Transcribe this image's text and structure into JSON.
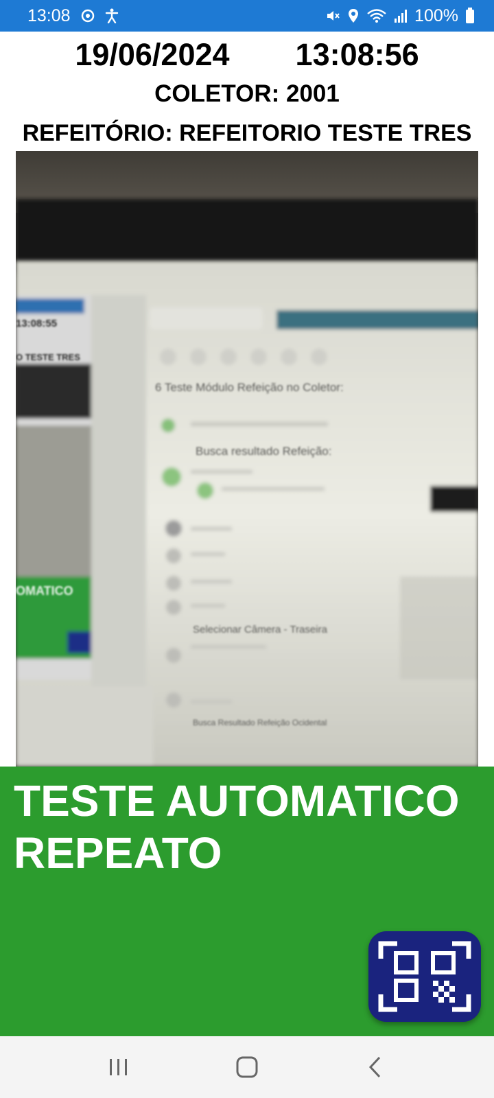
{
  "status_bar": {
    "time": "13:08",
    "battery": "100%",
    "icons_left": [
      "sync-icon",
      "accessibility-icon"
    ],
    "icons_right": [
      "mute-icon",
      "location-icon",
      "wifi-icon",
      "signal-icon",
      "battery-icon"
    ]
  },
  "header": {
    "date": "19/06/2024",
    "time": "13:08:56",
    "collector": "COLETOR: 2001",
    "refeitorio": "REFEITÓRIO: REFEITORIO TESTE TRES"
  },
  "camera": {
    "visible_text": {
      "small_time": "13:08:55",
      "small_teste": "O TESTE TRES",
      "step_title": "6 Teste Módulo Refeição no Coletor:",
      "busca": "Busca resultado Refeição:",
      "selecionar": "Selecionar Câmera - Traseira",
      "busca_final": "Busca Resultado Refeição Ocidental",
      "green_text": "OMATICO"
    }
  },
  "result": {
    "line1": "TESTE AUTOMATICO",
    "line2": "REPEATO",
    "qr_button_icon": "qr-scan-icon"
  },
  "navigation": {
    "buttons": [
      "recent-apps-icon",
      "home-icon",
      "back-icon"
    ]
  },
  "colors": {
    "status_bar": "#1e7ad4",
    "success_green": "#2c9c2e",
    "qr_button": "#1a237e"
  }
}
